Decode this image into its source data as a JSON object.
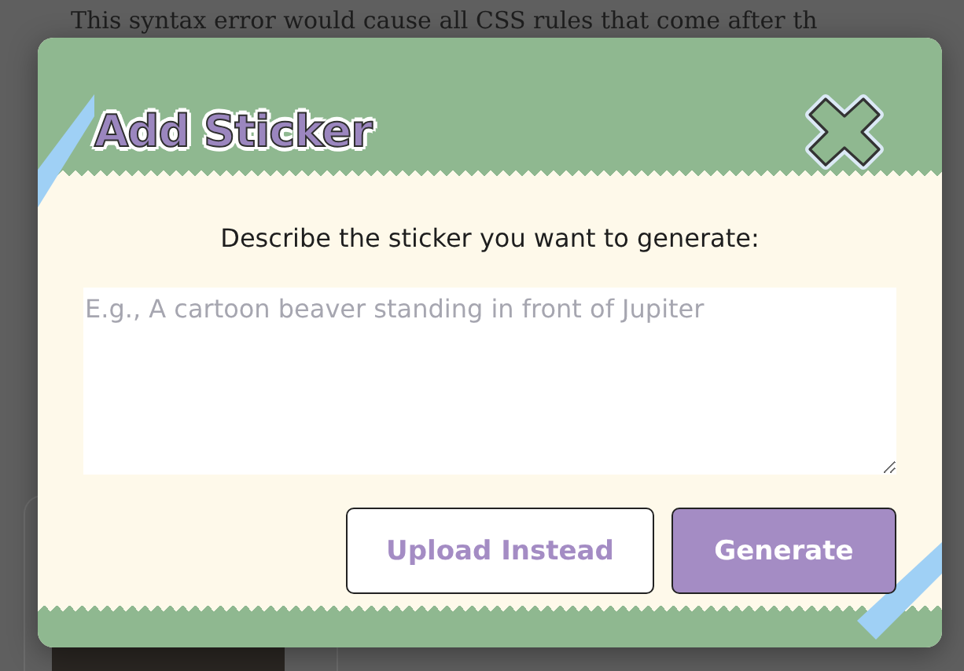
{
  "background": {
    "text": "This syntax error would cause all CSS rules that come after th"
  },
  "dialog": {
    "title": "Add Sticker",
    "prompt": "Describe the sticker you want to generate:",
    "field": {
      "placeholder": "E.g., A cartoon beaver standing in front of Jupiter"
    },
    "buttons": [
      {
        "label": "Upload Instead",
        "kind": "secondary"
      },
      {
        "label": "Generate",
        "kind": "primary"
      }
    ]
  }
}
